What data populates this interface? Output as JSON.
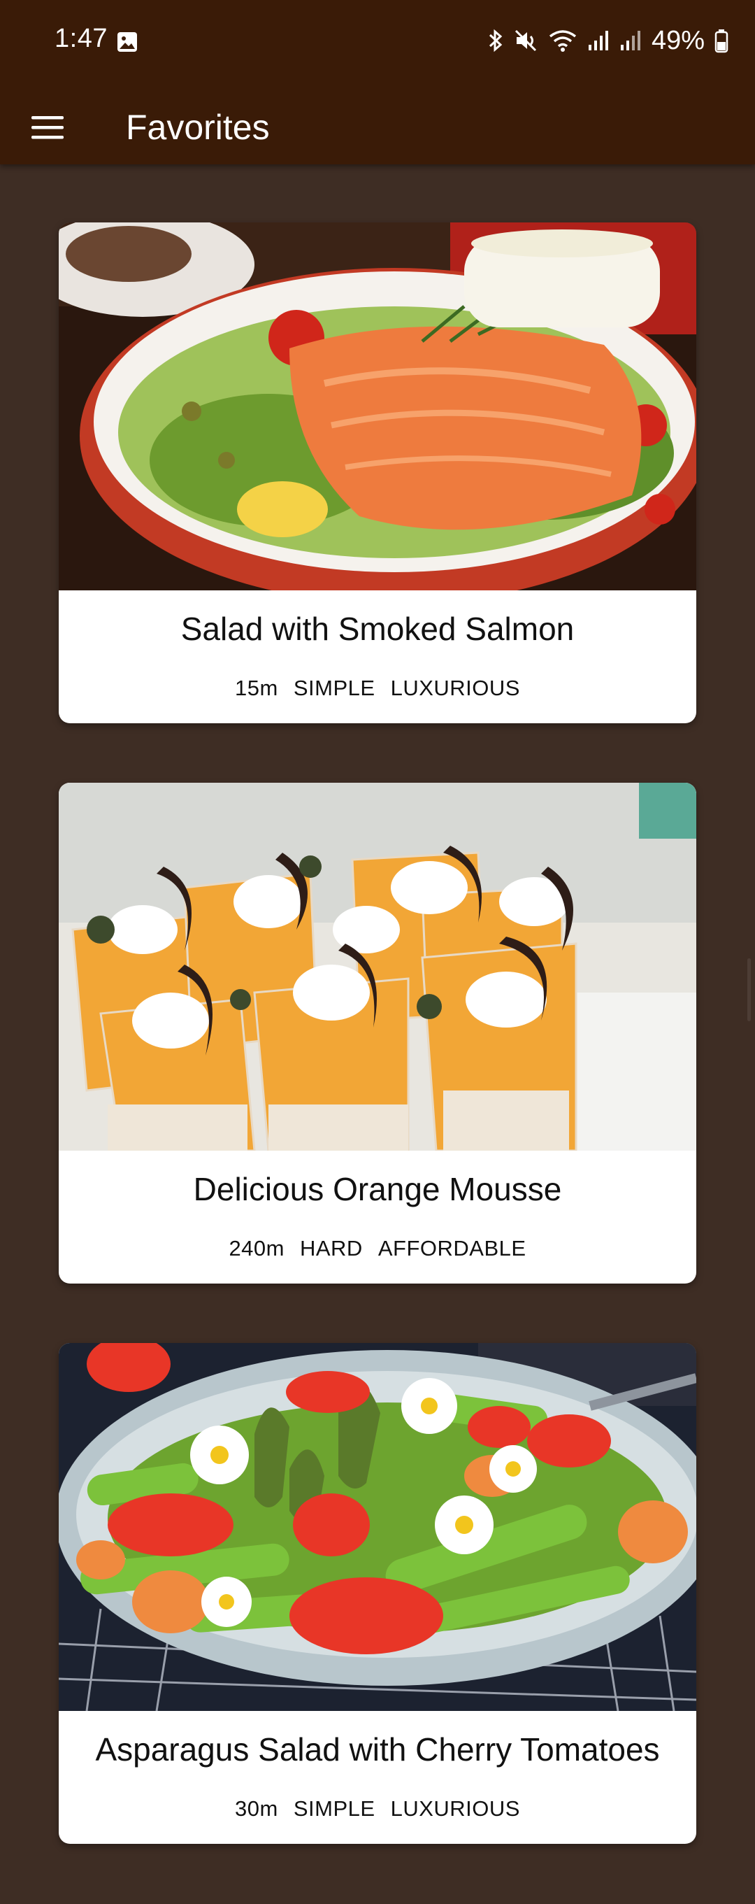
{
  "status_bar": {
    "time": "1:47",
    "battery": "49%",
    "icons": [
      "image-icon",
      "bluetooth-icon",
      "mute-icon",
      "wifi-icon",
      "signal-icon",
      "signal-2-icon",
      "battery-icon"
    ]
  },
  "app_bar": {
    "title": "Favorites",
    "menu_icon": "menu-icon"
  },
  "meals": [
    {
      "title": "Salad with Smoked Salmon",
      "duration": "15m",
      "complexity": "SIMPLE",
      "affordability": "LUXURIOUS"
    },
    {
      "title": "Delicious Orange Mousse",
      "duration": "240m",
      "complexity": "HARD",
      "affordability": "AFFORDABLE"
    },
    {
      "title": "Asparagus Salad with Cherry Tomatoes",
      "duration": "30m",
      "complexity": "SIMPLE",
      "affordability": "LUXURIOUS"
    }
  ],
  "colors": {
    "app_bar": "#3a1b07",
    "background": "#3e2d24",
    "card": "#ffffff"
  }
}
